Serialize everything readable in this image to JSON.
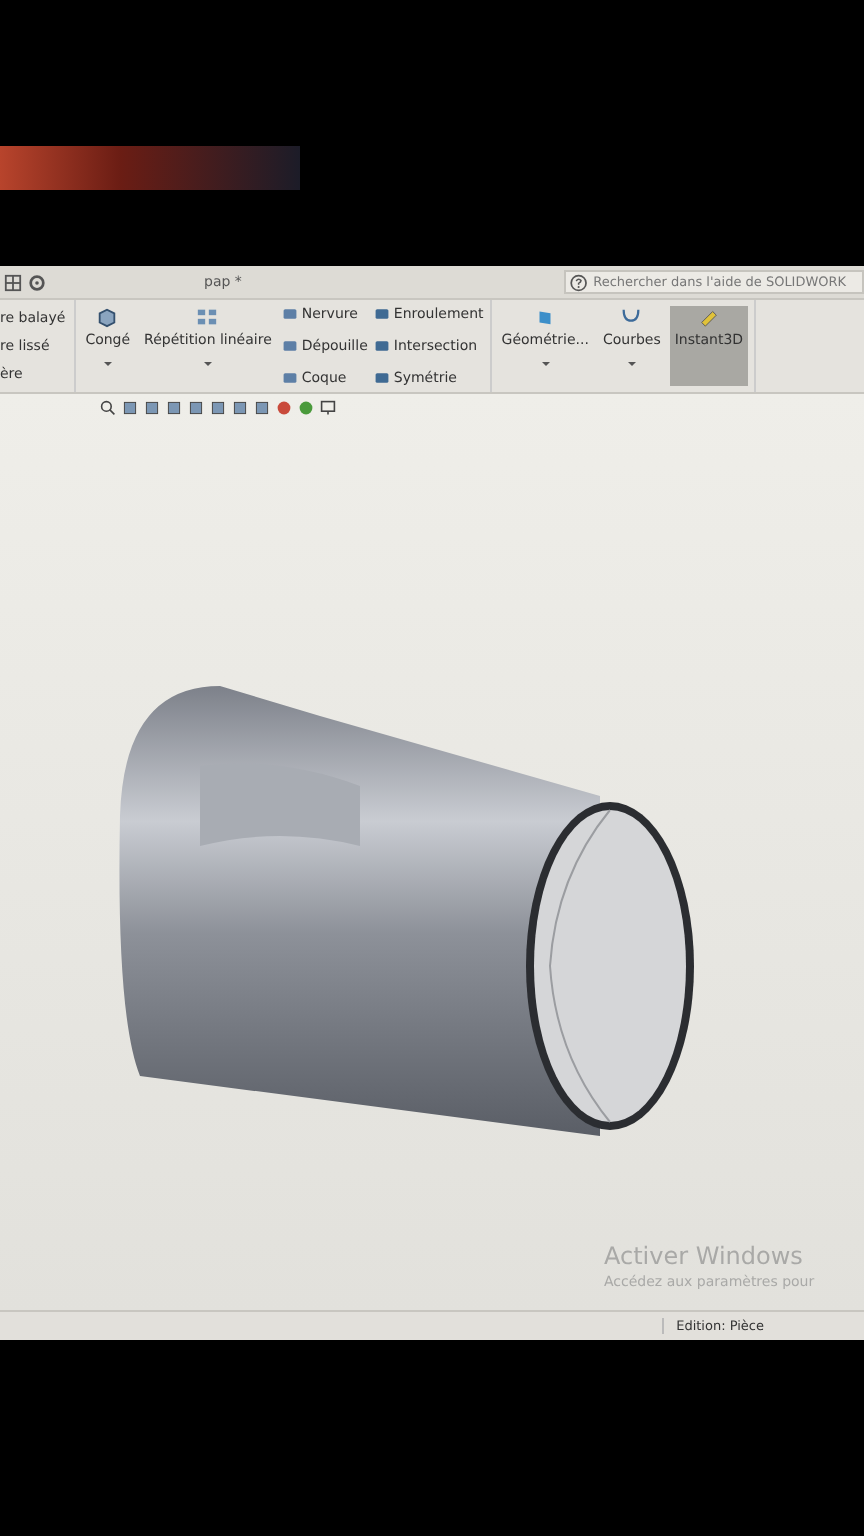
{
  "title_bar": {
    "title": "pap *",
    "help_search": {
      "placeholder": "Rechercher dans l'aide de SOLIDWORK"
    }
  },
  "ribbon": {
    "cut_items": [
      "re balayé",
      "re lissé",
      "ère"
    ],
    "large_buttons": [
      {
        "label": "Congé",
        "has_menu": true
      },
      {
        "label": "Répétition linéaire",
        "has_menu": true
      }
    ],
    "small_columns": [
      [
        "Nervure",
        "Dépouille",
        "Coque"
      ],
      [
        "Enroulement",
        "Intersection",
        "Symétrie"
      ]
    ],
    "right_buttons": [
      {
        "label": "Géométrie...",
        "selected": false,
        "has_menu": true
      },
      {
        "label": "Courbes",
        "selected": false,
        "has_menu": true
      },
      {
        "label": "Instant3D",
        "selected": true,
        "has_menu": false
      }
    ]
  },
  "watermark": {
    "title": "Activer Windows",
    "subtitle": "Accédez aux paramètres pour"
  },
  "status_bar": {
    "mode": "Edition: Pièce"
  }
}
